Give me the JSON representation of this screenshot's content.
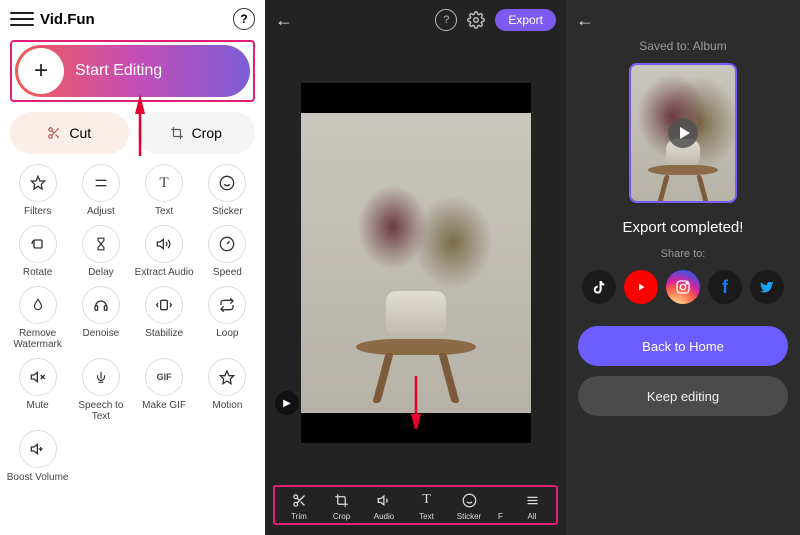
{
  "panel1": {
    "app_name": "Vid.Fun",
    "start_label": "Start Editing",
    "cut_label": "Cut",
    "crop_label": "Crop",
    "tools": [
      {
        "icon": "star",
        "label": "Filters"
      },
      {
        "icon": "equals",
        "label": "Adjust"
      },
      {
        "icon": "text",
        "label": "Text"
      },
      {
        "icon": "smile",
        "label": "Sticker"
      },
      {
        "icon": "rotate",
        "label": "Rotate"
      },
      {
        "icon": "hourglass",
        "label": "Delay"
      },
      {
        "icon": "audio-out",
        "label": "Extract Audio"
      },
      {
        "icon": "speedo",
        "label": "Speed"
      },
      {
        "icon": "drop",
        "label": "Remove Watermark"
      },
      {
        "icon": "headset",
        "label": "Denoise"
      },
      {
        "icon": "stabilize",
        "label": "Stabilize"
      },
      {
        "icon": "loop",
        "label": "Loop"
      },
      {
        "icon": "mute",
        "label": "Mute"
      },
      {
        "icon": "speech",
        "label": "Speech to Text"
      },
      {
        "icon": "gif",
        "label": "Make GIF"
      },
      {
        "icon": "motion",
        "label": "Motion"
      },
      {
        "icon": "boost",
        "label": "Boost Volume"
      }
    ]
  },
  "panel2": {
    "export_label": "Export",
    "toolbar": [
      {
        "icon": "scissors",
        "label": "Trim"
      },
      {
        "icon": "crop",
        "label": "Crop"
      },
      {
        "icon": "audio",
        "label": "Audio"
      },
      {
        "icon": "text",
        "label": "Text"
      },
      {
        "icon": "smile",
        "label": "Sticker"
      },
      {
        "icon": "f",
        "label": "F"
      },
      {
        "icon": "all",
        "label": "All"
      }
    ]
  },
  "panel3": {
    "saved_to": "Saved to: Album",
    "completed": "Export completed!",
    "share_to": "Share to:",
    "social": [
      "tiktok",
      "youtube",
      "instagram",
      "facebook",
      "twitter"
    ],
    "back_home": "Back to Home",
    "keep_editing": "Keep editing"
  }
}
